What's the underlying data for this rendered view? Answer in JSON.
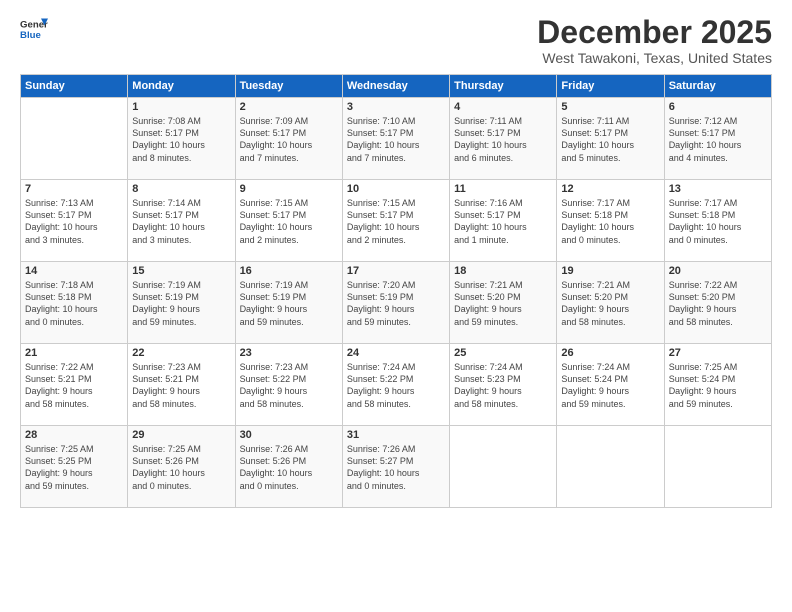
{
  "header": {
    "logo_line1": "General",
    "logo_line2": "Blue",
    "month": "December 2025",
    "location": "West Tawakoni, Texas, United States"
  },
  "days_of_week": [
    "Sunday",
    "Monday",
    "Tuesday",
    "Wednesday",
    "Thursday",
    "Friday",
    "Saturday"
  ],
  "weeks": [
    [
      {
        "num": "",
        "info": ""
      },
      {
        "num": "1",
        "info": "Sunrise: 7:08 AM\nSunset: 5:17 PM\nDaylight: 10 hours\nand 8 minutes."
      },
      {
        "num": "2",
        "info": "Sunrise: 7:09 AM\nSunset: 5:17 PM\nDaylight: 10 hours\nand 7 minutes."
      },
      {
        "num": "3",
        "info": "Sunrise: 7:10 AM\nSunset: 5:17 PM\nDaylight: 10 hours\nand 7 minutes."
      },
      {
        "num": "4",
        "info": "Sunrise: 7:11 AM\nSunset: 5:17 PM\nDaylight: 10 hours\nand 6 minutes."
      },
      {
        "num": "5",
        "info": "Sunrise: 7:11 AM\nSunset: 5:17 PM\nDaylight: 10 hours\nand 5 minutes."
      },
      {
        "num": "6",
        "info": "Sunrise: 7:12 AM\nSunset: 5:17 PM\nDaylight: 10 hours\nand 4 minutes."
      }
    ],
    [
      {
        "num": "7",
        "info": "Sunrise: 7:13 AM\nSunset: 5:17 PM\nDaylight: 10 hours\nand 3 minutes."
      },
      {
        "num": "8",
        "info": "Sunrise: 7:14 AM\nSunset: 5:17 PM\nDaylight: 10 hours\nand 3 minutes."
      },
      {
        "num": "9",
        "info": "Sunrise: 7:15 AM\nSunset: 5:17 PM\nDaylight: 10 hours\nand 2 minutes."
      },
      {
        "num": "10",
        "info": "Sunrise: 7:15 AM\nSunset: 5:17 PM\nDaylight: 10 hours\nand 2 minutes."
      },
      {
        "num": "11",
        "info": "Sunrise: 7:16 AM\nSunset: 5:17 PM\nDaylight: 10 hours\nand 1 minute."
      },
      {
        "num": "12",
        "info": "Sunrise: 7:17 AM\nSunset: 5:18 PM\nDaylight: 10 hours\nand 0 minutes."
      },
      {
        "num": "13",
        "info": "Sunrise: 7:17 AM\nSunset: 5:18 PM\nDaylight: 10 hours\nand 0 minutes."
      }
    ],
    [
      {
        "num": "14",
        "info": "Sunrise: 7:18 AM\nSunset: 5:18 PM\nDaylight: 10 hours\nand 0 minutes."
      },
      {
        "num": "15",
        "info": "Sunrise: 7:19 AM\nSunset: 5:19 PM\nDaylight: 9 hours\nand 59 minutes."
      },
      {
        "num": "16",
        "info": "Sunrise: 7:19 AM\nSunset: 5:19 PM\nDaylight: 9 hours\nand 59 minutes."
      },
      {
        "num": "17",
        "info": "Sunrise: 7:20 AM\nSunset: 5:19 PM\nDaylight: 9 hours\nand 59 minutes."
      },
      {
        "num": "18",
        "info": "Sunrise: 7:21 AM\nSunset: 5:20 PM\nDaylight: 9 hours\nand 59 minutes."
      },
      {
        "num": "19",
        "info": "Sunrise: 7:21 AM\nSunset: 5:20 PM\nDaylight: 9 hours\nand 58 minutes."
      },
      {
        "num": "20",
        "info": "Sunrise: 7:22 AM\nSunset: 5:20 PM\nDaylight: 9 hours\nand 58 minutes."
      }
    ],
    [
      {
        "num": "21",
        "info": "Sunrise: 7:22 AM\nSunset: 5:21 PM\nDaylight: 9 hours\nand 58 minutes."
      },
      {
        "num": "22",
        "info": "Sunrise: 7:23 AM\nSunset: 5:21 PM\nDaylight: 9 hours\nand 58 minutes."
      },
      {
        "num": "23",
        "info": "Sunrise: 7:23 AM\nSunset: 5:22 PM\nDaylight: 9 hours\nand 58 minutes."
      },
      {
        "num": "24",
        "info": "Sunrise: 7:24 AM\nSunset: 5:22 PM\nDaylight: 9 hours\nand 58 minutes."
      },
      {
        "num": "25",
        "info": "Sunrise: 7:24 AM\nSunset: 5:23 PM\nDaylight: 9 hours\nand 58 minutes."
      },
      {
        "num": "26",
        "info": "Sunrise: 7:24 AM\nSunset: 5:24 PM\nDaylight: 9 hours\nand 59 minutes."
      },
      {
        "num": "27",
        "info": "Sunrise: 7:25 AM\nSunset: 5:24 PM\nDaylight: 9 hours\nand 59 minutes."
      }
    ],
    [
      {
        "num": "28",
        "info": "Sunrise: 7:25 AM\nSunset: 5:25 PM\nDaylight: 9 hours\nand 59 minutes."
      },
      {
        "num": "29",
        "info": "Sunrise: 7:25 AM\nSunset: 5:26 PM\nDaylight: 10 hours\nand 0 minutes."
      },
      {
        "num": "30",
        "info": "Sunrise: 7:26 AM\nSunset: 5:26 PM\nDaylight: 10 hours\nand 0 minutes."
      },
      {
        "num": "31",
        "info": "Sunrise: 7:26 AM\nSunset: 5:27 PM\nDaylight: 10 hours\nand 0 minutes."
      },
      {
        "num": "",
        "info": ""
      },
      {
        "num": "",
        "info": ""
      },
      {
        "num": "",
        "info": ""
      }
    ]
  ]
}
